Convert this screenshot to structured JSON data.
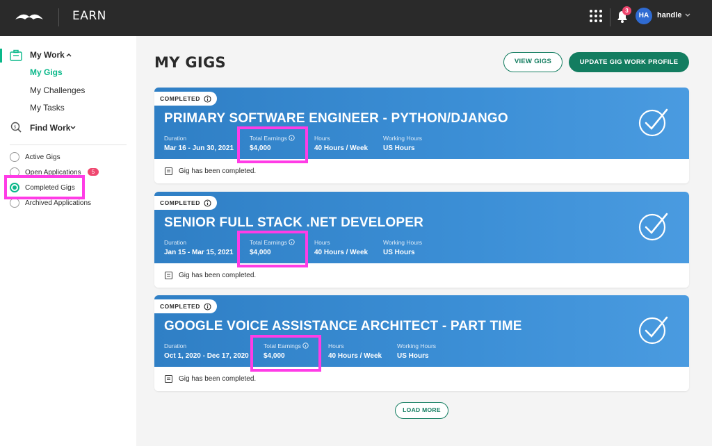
{
  "header": {
    "app_title": "EARN",
    "notifications_count": "3",
    "avatar_initials": "HA",
    "username": "handle"
  },
  "sidebar": {
    "my_work": "My Work",
    "my_gigs": "My Gigs",
    "my_challenges": "My Challenges",
    "my_tasks": "My Tasks",
    "find_work": "Find Work",
    "filters": [
      {
        "label": "Active Gigs",
        "checked": false
      },
      {
        "label": "Open Applications",
        "checked": false,
        "count": "5"
      },
      {
        "label": "Completed Gigs",
        "checked": true
      },
      {
        "label": "Archived Applications",
        "checked": false
      }
    ]
  },
  "main": {
    "title": "MY GIGS",
    "view_gigs_label": "VIEW GIGS",
    "update_profile_label": "UPDATE GIG WORK PROFILE",
    "load_more_label": "LOAD MORE",
    "gigs": [
      {
        "status": "COMPLETED",
        "title": "PRIMARY SOFTWARE ENGINEER - PYTHON/DJANGO",
        "duration_label": "Duration",
        "duration": "Mar 16 - Jun 30, 2021",
        "earnings_label": "Total Earnings",
        "earnings": "$4,000",
        "hours_label": "Hours",
        "hours": "40 Hours / Week",
        "working_hours_label": "Working Hours",
        "working_hours": "US Hours",
        "note": "Gig has been completed."
      },
      {
        "status": "COMPLETED",
        "title": "SENIOR FULL STACK .NET DEVELOPER",
        "duration_label": "Duration",
        "duration": "Jan 15 - Mar 15, 2021",
        "earnings_label": "Total Earnings",
        "earnings": "$4,000",
        "hours_label": "Hours",
        "hours": "40 Hours / Week",
        "working_hours_label": "Working Hours",
        "working_hours": "US Hours",
        "note": "Gig has been completed."
      },
      {
        "status": "COMPLETED",
        "title": "GOOGLE VOICE ASSISTANCE ARCHITECT - PART TIME",
        "duration_label": "Duration",
        "duration": "Oct 1, 2020 - Dec 17, 2020",
        "earnings_label": "Total Earnings",
        "earnings": "$4,000",
        "hours_label": "Hours",
        "hours": "40 Hours / Week",
        "working_hours_label": "Working Hours",
        "working_hours": "US Hours",
        "note": "Gig has been completed."
      }
    ]
  },
  "colors": {
    "header_bg": "#2a2a2a",
    "accent_green": "#0ab88a",
    "button_green": "#137d60",
    "card_blue": "#3c8fd6",
    "badge_red": "#ef476f",
    "highlight_magenta": "#ff3ce6"
  },
  "icons": [
    "logo-icon",
    "apps-grid-icon",
    "bell-icon",
    "chevron-down-icon",
    "briefcase-icon",
    "search-icon",
    "info-icon",
    "check-circle-icon",
    "note-icon"
  ]
}
